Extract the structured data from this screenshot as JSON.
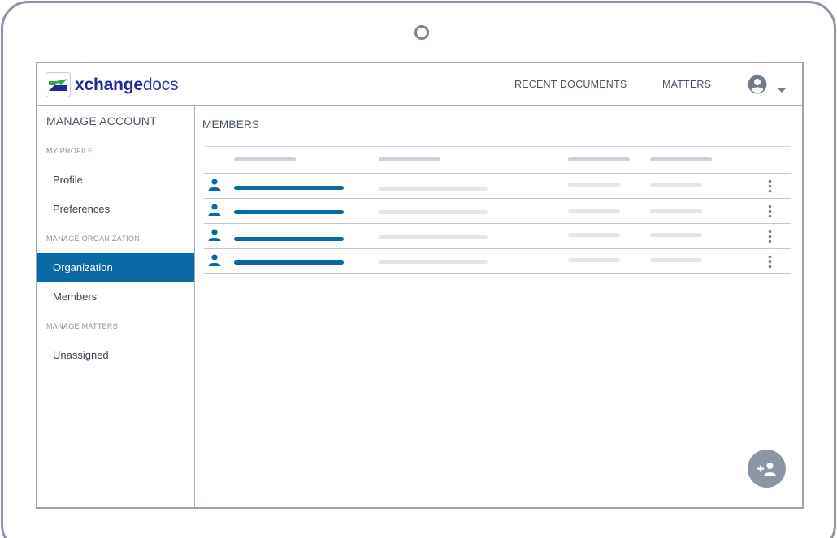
{
  "header": {
    "logo": {
      "text_strong": "xchange",
      "text_light": "docs"
    },
    "nav": [
      {
        "label": "RECENT DOCUMENTS"
      },
      {
        "label": "MATTERS"
      }
    ],
    "icons": {
      "avatar": "account-circle-icon",
      "caret": "chevron-down-icon"
    }
  },
  "sidebar": {
    "title": "MANAGE ACCOUNT",
    "sections": [
      {
        "label": "MY PROFILE",
        "items": [
          "Profile",
          "Preferences"
        ]
      },
      {
        "label": "MANAGE ORGANIZATION",
        "items": [
          "Organization",
          "Members"
        ]
      },
      {
        "label": "MANAGE MATTERS",
        "items": [
          "Unassigned"
        ]
      }
    ],
    "active_item": "Organization"
  },
  "main": {
    "title": "MEMBERS",
    "row_count": 4,
    "row_icon": "person-icon",
    "row_menu_icon": "more-vertical-icon"
  },
  "fab": {
    "icon": "add-person-icon"
  },
  "colors": {
    "brand_blue": "#0b68a6",
    "logo_navy": "#1a2a9c",
    "logo_green": "#2ea84a",
    "skeleton_dark": "#cdd3dc",
    "skeleton_light": "#e3e7ec",
    "fab_gray": "#8d96a4"
  }
}
